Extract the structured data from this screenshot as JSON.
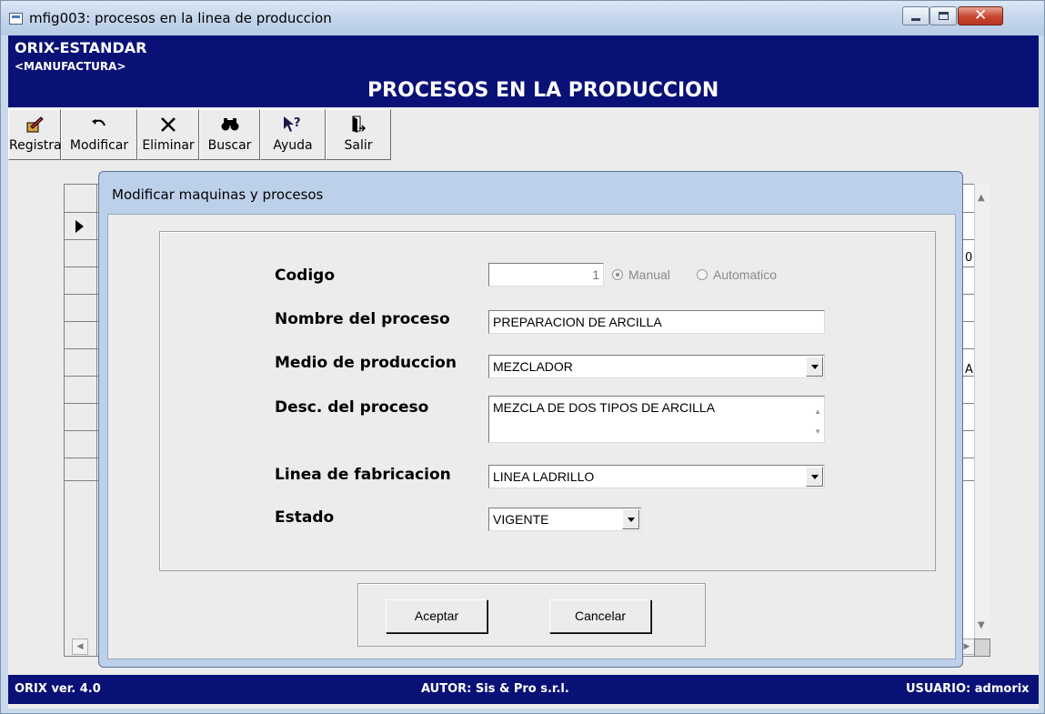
{
  "window": {
    "title": "mfig003: procesos en la linea de produccion"
  },
  "banner": {
    "brand": "ORIX-ESTANDAR",
    "module": "<MANUFACTURA>",
    "title": "PROCESOS EN LA PRODUCCION"
  },
  "toolbar": {
    "registrar": "Registrar",
    "modificar": "Modificar",
    "eliminar": "Eliminar",
    "buscar": "Buscar",
    "ayuda": "Ayuda",
    "salir": "Salir"
  },
  "grid_peek": {
    "row2_tail": "0",
    "row5_tail": "A"
  },
  "dialog": {
    "title": "Modificar maquinas y procesos",
    "codigo_label": "Codigo",
    "codigo_value": "1",
    "radio_manual": "Manual",
    "radio_automatico": "Automatico",
    "radio_selected": "Manual",
    "nombre_label": "Nombre del proceso",
    "nombre_value": "PREPARACION DE ARCILLA",
    "medio_label": "Medio de produccion",
    "medio_value": "MEZCLADOR",
    "desc_label": "Desc. del proceso",
    "desc_value": "MEZCLA DE DOS TIPOS DE ARCILLA",
    "linea_label": "Linea de  fabricacion",
    "linea_value": "LINEA LADRILLO",
    "estado_label": "Estado",
    "estado_value": "VIGENTE",
    "aceptar": "Aceptar",
    "cancelar": "Cancelar"
  },
  "statusbar": {
    "version": "ORIX ver. 4.0",
    "autor": "AUTOR: Sis & Pro s.r.l.",
    "usuario": "USUARIO: admorix"
  },
  "colors": {
    "banner": "#0a1176",
    "dialog_frame": "#bcd0ea",
    "client": "#ececec"
  }
}
